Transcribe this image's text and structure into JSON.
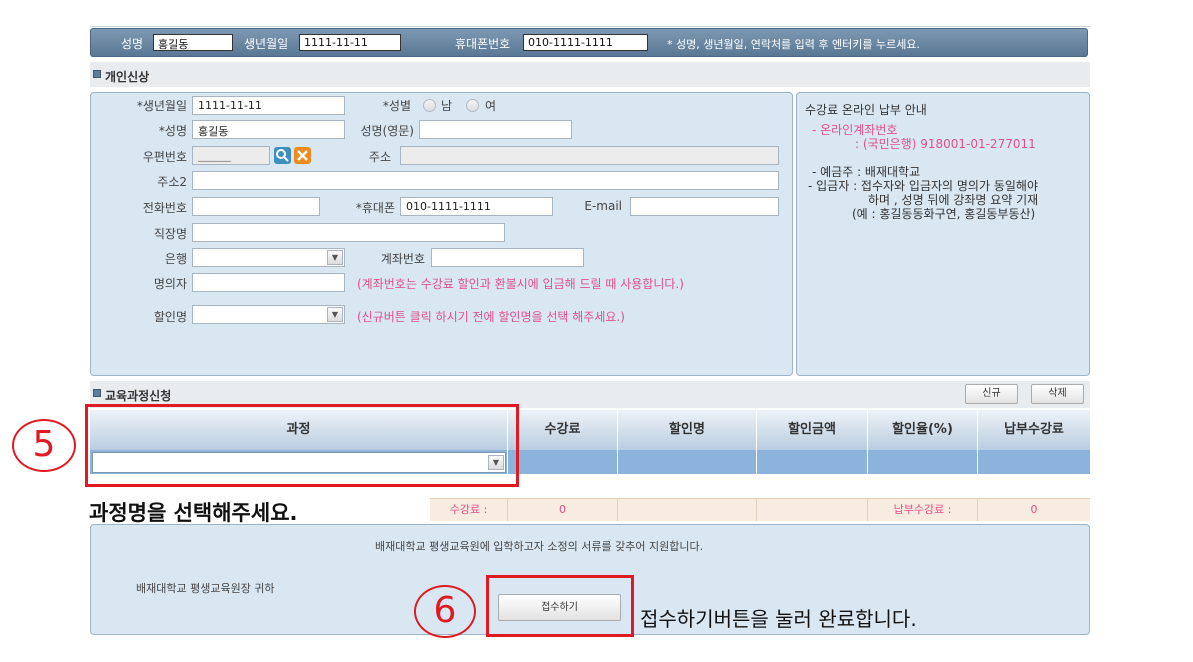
{
  "topbar": {
    "name_label": "성명",
    "name_value": "홍길동",
    "birth_label": "생년월일",
    "birth_value": "1111-11-11",
    "phone_label": "휴대폰번호",
    "phone_value": "010-1111-1111",
    "hint": "* 성명, 생년월일, 연락처를 입력 후 엔터키를 누르세요."
  },
  "personal": {
    "title": "개인신상",
    "birth_label": "*생년월일",
    "birth_value": "1111-11-11",
    "gender_label": "*성별",
    "gender_male": "남",
    "gender_female": "여",
    "name_label": "*성명",
    "name_value": "홍길동",
    "name_en_label": "성명(영문)",
    "name_en_value": "",
    "zip_label": "우편번호",
    "zip_value": "______",
    "addr_label": "주소",
    "addr_value": "",
    "addr2_label": "주소2",
    "addr2_value": "",
    "tel_label": "전화번호",
    "tel_value": "",
    "mobile_label": "*휴대폰",
    "mobile_value": "010-1111-1111",
    "email_label": "E-mail",
    "email_value": "",
    "company_label": "직장명",
    "company_value": "",
    "bank_label": "은행",
    "bank_value": "",
    "account_label": "계좌번호",
    "account_value": "",
    "holder_label": "명의자",
    "holder_value": "",
    "holder_note": "(계좌번호는 수강료 할인과 환불시에 입금해 드릴 때 사용합니다.)",
    "discount_label": "할인명",
    "discount_value": "",
    "discount_note": "(신규버튼 클릭 하시기 전에 할인명을 선택 해주세요.)"
  },
  "payment_guide": {
    "title": "수강료 온라인 납부 안내",
    "line1": "- 온라인계좌번호",
    "line2": ": (국민은행) 918001-01-277011",
    "line3": "- 예금주 : 배재대학교",
    "line4": "- 입금자 : 접수자와 입금자의 명의가 동일해야",
    "line5": "하며 , 성명 뒤에 강좌명 요약 기재",
    "line6": "(예 : 홍길동동화구연, 홍길동부동산)"
  },
  "course": {
    "title": "교육과정신청",
    "new_button": "신규",
    "delete_button": "삭제",
    "columns": [
      "과정",
      "수강료",
      "할인명",
      "할인금액",
      "할인율(%)",
      "납부수강료"
    ],
    "course_value": "",
    "fee_label": "수강료 :",
    "fee_value": "0",
    "pay_label": "납부수강료 :",
    "pay_value": "0"
  },
  "footer": {
    "statement": "배재대학교 평생교육원에 입학하고자 소정의 서류를 갖추어 지원합니다.",
    "addressee": "배재대학교 평생교육원장 귀하",
    "submit_button": "접수하기"
  },
  "annotations": {
    "step5_number": "5",
    "step5_text": "과정명을 선택해주세요.",
    "step6_number": "6",
    "step6_text": "접수하기버튼을 눌러 완료합니다."
  },
  "colors": {
    "accent_red": "#e01a22",
    "note_pink": "#e0508a",
    "panel_blue": "#d9e7f2",
    "topbar": "#6a87a3"
  },
  "icons": {
    "search": "search-icon",
    "clear": "close-icon",
    "dropdown": "chevron-down-icon"
  }
}
